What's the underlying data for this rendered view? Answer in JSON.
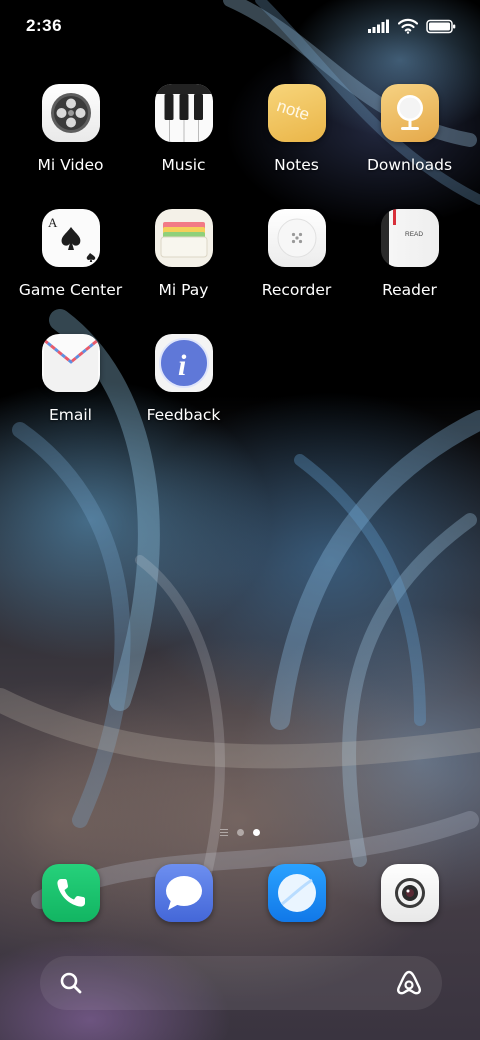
{
  "status_bar": {
    "time": "2:36",
    "icons": [
      "signal-icon",
      "wifi-icon",
      "battery-icon"
    ]
  },
  "apps": [
    {
      "label": "Mi Video",
      "icon": "mi-video-icon"
    },
    {
      "label": "Music",
      "icon": "music-icon"
    },
    {
      "label": "Notes",
      "icon": "notes-icon",
      "icon_text": "note"
    },
    {
      "label": "Downloads",
      "icon": "downloads-icon"
    },
    {
      "label": "Game Center",
      "icon": "game-center-icon",
      "icon_text": "A"
    },
    {
      "label": "Mi Pay",
      "icon": "mi-pay-icon"
    },
    {
      "label": "Recorder",
      "icon": "recorder-icon"
    },
    {
      "label": "Reader",
      "icon": "reader-icon",
      "icon_text": "READ"
    },
    {
      "label": "Email",
      "icon": "email-icon"
    },
    {
      "label": "Feedback",
      "icon": "feedback-icon",
      "icon_text": "i"
    }
  ],
  "page_indicator": {
    "pages": 2,
    "active_page": 2,
    "has_minus_one_screen": true
  },
  "dock": [
    {
      "icon": "phone-icon"
    },
    {
      "icon": "messages-icon"
    },
    {
      "icon": "browser-icon"
    },
    {
      "icon": "camera-icon"
    }
  ],
  "search_bar": {
    "left_icon": "search-icon",
    "right_icon": "assistant-icon"
  },
  "colors": {
    "phone_green": "#1ec76e",
    "messages_blue": "#4d73e0",
    "browser_blue": "#1d8ef5",
    "notes_yellow": "#f2c257"
  }
}
